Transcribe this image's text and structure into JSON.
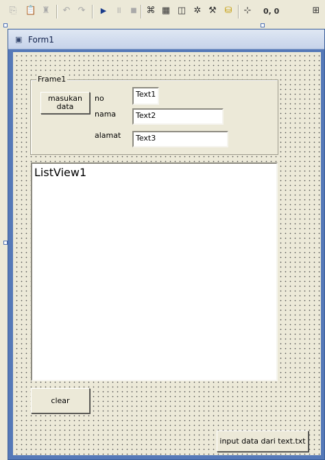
{
  "toolbar": {
    "icons": [
      "copy-icon",
      "paste-icon",
      "find-icon",
      "undo-icon",
      "redo-icon",
      "start-icon",
      "break-icon",
      "end-icon",
      "project-explorer-icon",
      "properties-window-icon",
      "form-layout-icon",
      "object-browser-icon",
      "toolbox-icon",
      "data-view-icon",
      "position-icon",
      "size-icon"
    ],
    "coordinates": "0, 0"
  },
  "form": {
    "title": "Form1",
    "frame": {
      "caption": "Frame1",
      "button_label": "masukan data",
      "labels": [
        "no",
        "nama",
        "alamat"
      ],
      "textboxes": [
        "Text1",
        "Text2",
        "Text3"
      ]
    },
    "listview_label": "ListView1",
    "clear_label": "clear",
    "input_button_label": "input data dari  text.txt"
  }
}
